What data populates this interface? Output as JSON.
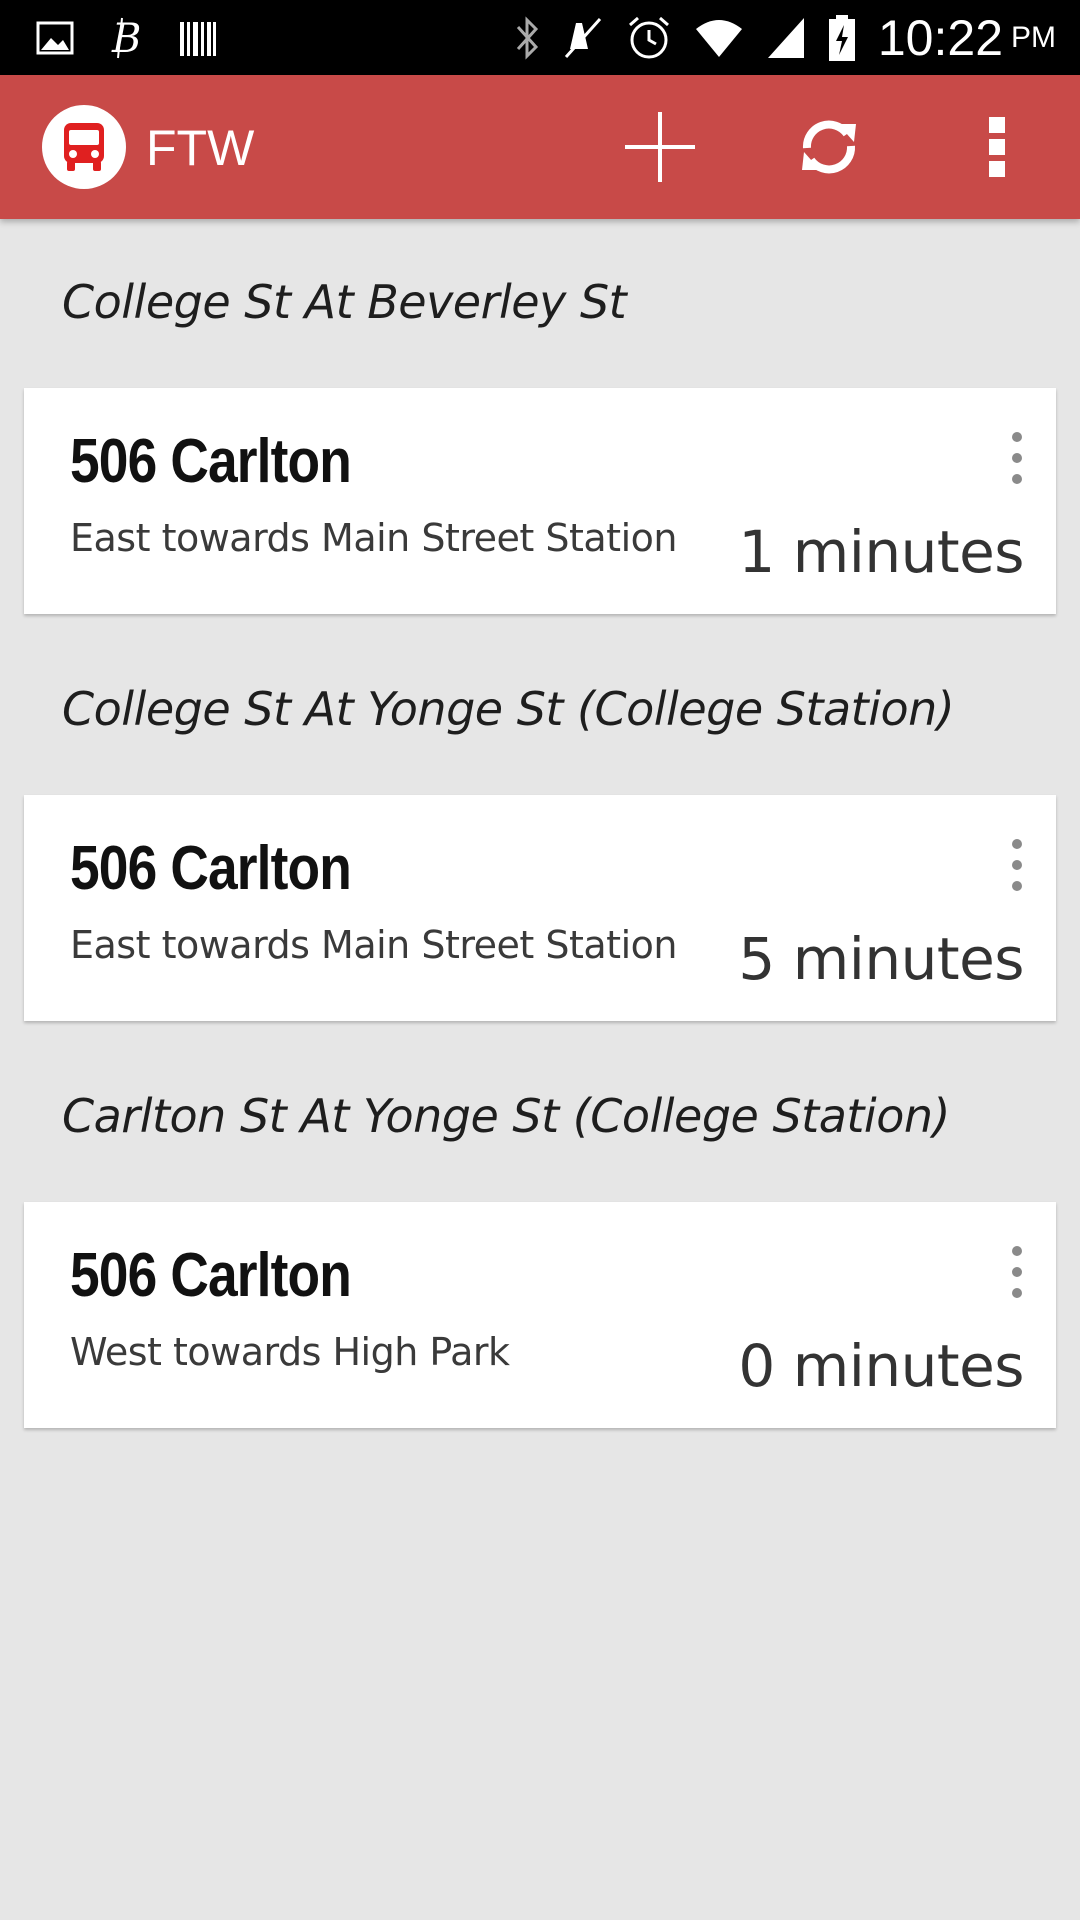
{
  "status_bar": {
    "time": "10:22",
    "ampm": "PM",
    "left_icons": [
      "image-icon",
      "bitcoin-icon",
      "barcode-icon"
    ],
    "right_icons": [
      "bluetooth-icon",
      "mute-icon",
      "alarm-icon",
      "wifi-icon",
      "signal-icon",
      "battery-charging-icon"
    ]
  },
  "app_bar": {
    "title": "FTW",
    "logo_icon": "bus-icon",
    "actions": [
      "add-icon",
      "refresh-icon",
      "overflow-menu-icon"
    ],
    "color": "#c84a48"
  },
  "stops": [
    {
      "name": "College St At Beverley St",
      "predictions": [
        {
          "route": "506 Carlton",
          "direction": "East towards Main Street Station",
          "eta": "1 minutes"
        }
      ]
    },
    {
      "name": "College St At Yonge St (College Station)",
      "predictions": [
        {
          "route": "506 Carlton",
          "direction": "East towards Main Street Station",
          "eta": "5 minutes"
        }
      ]
    },
    {
      "name": "Carlton St At Yonge St (College Station)",
      "predictions": [
        {
          "route": "506 Carlton",
          "direction": "West towards High Park",
          "eta": "0 minutes"
        }
      ]
    }
  ]
}
